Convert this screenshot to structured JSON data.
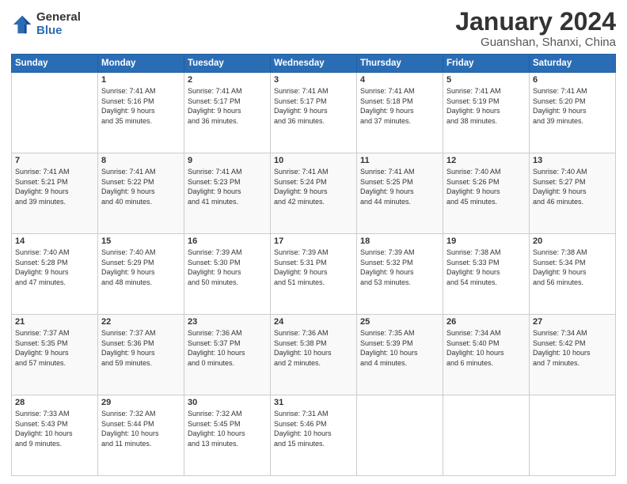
{
  "logo": {
    "general": "General",
    "blue": "Blue"
  },
  "header": {
    "month": "January 2024",
    "location": "Guanshan, Shanxi, China"
  },
  "columns": [
    "Sunday",
    "Monday",
    "Tuesday",
    "Wednesday",
    "Thursday",
    "Friday",
    "Saturday"
  ],
  "weeks": [
    [
      {
        "day": "",
        "content": ""
      },
      {
        "day": "1",
        "content": "Sunrise: 7:41 AM\nSunset: 5:16 PM\nDaylight: 9 hours\nand 35 minutes."
      },
      {
        "day": "2",
        "content": "Sunrise: 7:41 AM\nSunset: 5:17 PM\nDaylight: 9 hours\nand 36 minutes."
      },
      {
        "day": "3",
        "content": "Sunrise: 7:41 AM\nSunset: 5:17 PM\nDaylight: 9 hours\nand 36 minutes."
      },
      {
        "day": "4",
        "content": "Sunrise: 7:41 AM\nSunset: 5:18 PM\nDaylight: 9 hours\nand 37 minutes."
      },
      {
        "day": "5",
        "content": "Sunrise: 7:41 AM\nSunset: 5:19 PM\nDaylight: 9 hours\nand 38 minutes."
      },
      {
        "day": "6",
        "content": "Sunrise: 7:41 AM\nSunset: 5:20 PM\nDaylight: 9 hours\nand 39 minutes."
      }
    ],
    [
      {
        "day": "7",
        "content": "Sunrise: 7:41 AM\nSunset: 5:21 PM\nDaylight: 9 hours\nand 39 minutes."
      },
      {
        "day": "8",
        "content": "Sunrise: 7:41 AM\nSunset: 5:22 PM\nDaylight: 9 hours\nand 40 minutes."
      },
      {
        "day": "9",
        "content": "Sunrise: 7:41 AM\nSunset: 5:23 PM\nDaylight: 9 hours\nand 41 minutes."
      },
      {
        "day": "10",
        "content": "Sunrise: 7:41 AM\nSunset: 5:24 PM\nDaylight: 9 hours\nand 42 minutes."
      },
      {
        "day": "11",
        "content": "Sunrise: 7:41 AM\nSunset: 5:25 PM\nDaylight: 9 hours\nand 44 minutes."
      },
      {
        "day": "12",
        "content": "Sunrise: 7:40 AM\nSunset: 5:26 PM\nDaylight: 9 hours\nand 45 minutes."
      },
      {
        "day": "13",
        "content": "Sunrise: 7:40 AM\nSunset: 5:27 PM\nDaylight: 9 hours\nand 46 minutes."
      }
    ],
    [
      {
        "day": "14",
        "content": "Sunrise: 7:40 AM\nSunset: 5:28 PM\nDaylight: 9 hours\nand 47 minutes."
      },
      {
        "day": "15",
        "content": "Sunrise: 7:40 AM\nSunset: 5:29 PM\nDaylight: 9 hours\nand 48 minutes."
      },
      {
        "day": "16",
        "content": "Sunrise: 7:39 AM\nSunset: 5:30 PM\nDaylight: 9 hours\nand 50 minutes."
      },
      {
        "day": "17",
        "content": "Sunrise: 7:39 AM\nSunset: 5:31 PM\nDaylight: 9 hours\nand 51 minutes."
      },
      {
        "day": "18",
        "content": "Sunrise: 7:39 AM\nSunset: 5:32 PM\nDaylight: 9 hours\nand 53 minutes."
      },
      {
        "day": "19",
        "content": "Sunrise: 7:38 AM\nSunset: 5:33 PM\nDaylight: 9 hours\nand 54 minutes."
      },
      {
        "day": "20",
        "content": "Sunrise: 7:38 AM\nSunset: 5:34 PM\nDaylight: 9 hours\nand 56 minutes."
      }
    ],
    [
      {
        "day": "21",
        "content": "Sunrise: 7:37 AM\nSunset: 5:35 PM\nDaylight: 9 hours\nand 57 minutes."
      },
      {
        "day": "22",
        "content": "Sunrise: 7:37 AM\nSunset: 5:36 PM\nDaylight: 9 hours\nand 59 minutes."
      },
      {
        "day": "23",
        "content": "Sunrise: 7:36 AM\nSunset: 5:37 PM\nDaylight: 10 hours\nand 0 minutes."
      },
      {
        "day": "24",
        "content": "Sunrise: 7:36 AM\nSunset: 5:38 PM\nDaylight: 10 hours\nand 2 minutes."
      },
      {
        "day": "25",
        "content": "Sunrise: 7:35 AM\nSunset: 5:39 PM\nDaylight: 10 hours\nand 4 minutes."
      },
      {
        "day": "26",
        "content": "Sunrise: 7:34 AM\nSunset: 5:40 PM\nDaylight: 10 hours\nand 6 minutes."
      },
      {
        "day": "27",
        "content": "Sunrise: 7:34 AM\nSunset: 5:42 PM\nDaylight: 10 hours\nand 7 minutes."
      }
    ],
    [
      {
        "day": "28",
        "content": "Sunrise: 7:33 AM\nSunset: 5:43 PM\nDaylight: 10 hours\nand 9 minutes."
      },
      {
        "day": "29",
        "content": "Sunrise: 7:32 AM\nSunset: 5:44 PM\nDaylight: 10 hours\nand 11 minutes."
      },
      {
        "day": "30",
        "content": "Sunrise: 7:32 AM\nSunset: 5:45 PM\nDaylight: 10 hours\nand 13 minutes."
      },
      {
        "day": "31",
        "content": "Sunrise: 7:31 AM\nSunset: 5:46 PM\nDaylight: 10 hours\nand 15 minutes."
      },
      {
        "day": "",
        "content": ""
      },
      {
        "day": "",
        "content": ""
      },
      {
        "day": "",
        "content": ""
      }
    ]
  ]
}
